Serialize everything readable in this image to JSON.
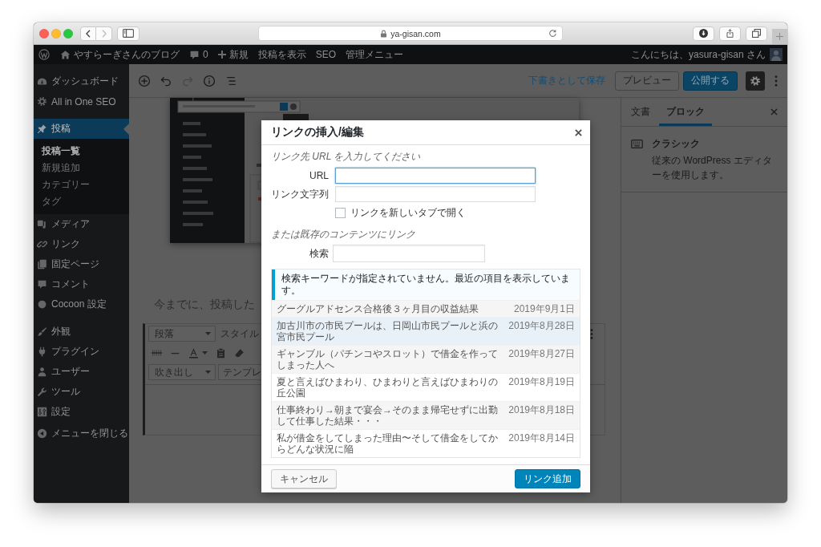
{
  "browser": {
    "address": "ya-gisan.com",
    "forward_disabled": true
  },
  "admin_bar": {
    "site_name": "やすらーぎさんのブログ",
    "comment_count": "0",
    "new_label": "新規",
    "links": [
      "投稿を表示",
      "SEO",
      "管理メニュー"
    ],
    "greeting": "こんにちは、yasura-gisan さん"
  },
  "sidebar": {
    "groups": [
      {
        "items": [
          {
            "label": "ダッシュボード",
            "selected": false
          },
          {
            "label": "All in One SEO",
            "selected": false
          }
        ]
      },
      {
        "items": [
          {
            "label": "投稿",
            "selected": true,
            "children": [
              {
                "label": "投稿一覧",
                "selected": true
              },
              {
                "label": "新規追加",
                "selected": false
              },
              {
                "label": "カテゴリー",
                "selected": false
              },
              {
                "label": "タグ",
                "selected": false
              }
            ]
          },
          {
            "label": "メディア",
            "selected": false
          },
          {
            "label": "リンク",
            "selected": false
          },
          {
            "label": "固定ページ",
            "selected": false
          },
          {
            "label": "コメント",
            "selected": false
          },
          {
            "label": "Cocoon 設定",
            "selected": false
          }
        ]
      },
      {
        "items": [
          {
            "label": "外観",
            "selected": false
          },
          {
            "label": "プラグイン",
            "selected": false
          },
          {
            "label": "ユーザー",
            "selected": false
          },
          {
            "label": "ツール",
            "selected": false
          },
          {
            "label": "設定",
            "selected": false
          }
        ]
      }
    ],
    "collapse_label": "メニューを閉じる"
  },
  "editor_toolbar": {
    "undo_disabled": false,
    "redo_disabled": true,
    "save_draft": "下書きとして保存",
    "preview": "プレビュー",
    "publish": "公開する",
    "settings_open": true
  },
  "content": {
    "heading": "今までに、投稿した",
    "classic_block": {
      "format": "段落",
      "styles": "スタイル",
      "balloon": "吹き出し",
      "template": "テンプレ"
    }
  },
  "settings_panel": {
    "tabs": [
      {
        "label": "文書",
        "selected": false
      },
      {
        "label": "ブロック",
        "selected": true
      }
    ],
    "block": {
      "name": "クラシック",
      "description": "従来の WordPress エディターを使用します。"
    }
  },
  "link_dialog": {
    "title": "リンクの挿入/編集",
    "instruction": "リンク先 URL を入力してください",
    "url_field": {
      "label": "URL",
      "focused": true
    },
    "text_field": {
      "label": "リンク文字列"
    },
    "new_tab": {
      "label": "リンクを新しいタブで開く",
      "checked": false
    },
    "existing_heading": "または既存のコンテンツにリンク",
    "search_field": {
      "label": "検索"
    },
    "notice": "検索キーワードが指定されていません。最近の項目を表示しています。",
    "results": [
      {
        "title": "グーグルアドセンス合格後３ヶ月目の収益結果",
        "date": "2019年9月1日",
        "selected": false
      },
      {
        "title": "加古川市の市民プールは、日岡山市民プールと浜の宮市民プール",
        "date": "2019年8月28日",
        "selected": true
      },
      {
        "title": "ギャンブル（パチンコやスロット）で借金を作ってしまった人へ",
        "date": "2019年8月27日",
        "selected": false
      },
      {
        "title": "夏と言えばひまわり、ひまわりと言えばひまわりの丘公園",
        "date": "2019年8月19日",
        "selected": false
      },
      {
        "title": "仕事終わり→朝まで宴会→そのまま帰宅せずに出勤して仕事した結果・・・",
        "date": "2019年8月18日",
        "selected": false
      },
      {
        "title": "私が借金をしてしまった理由〜そして借金をしてからどんな状況に陥",
        "date": "2019年8月14日",
        "selected": false
      }
    ],
    "cancel": "キャンセル",
    "submit": "リンク追加"
  }
}
